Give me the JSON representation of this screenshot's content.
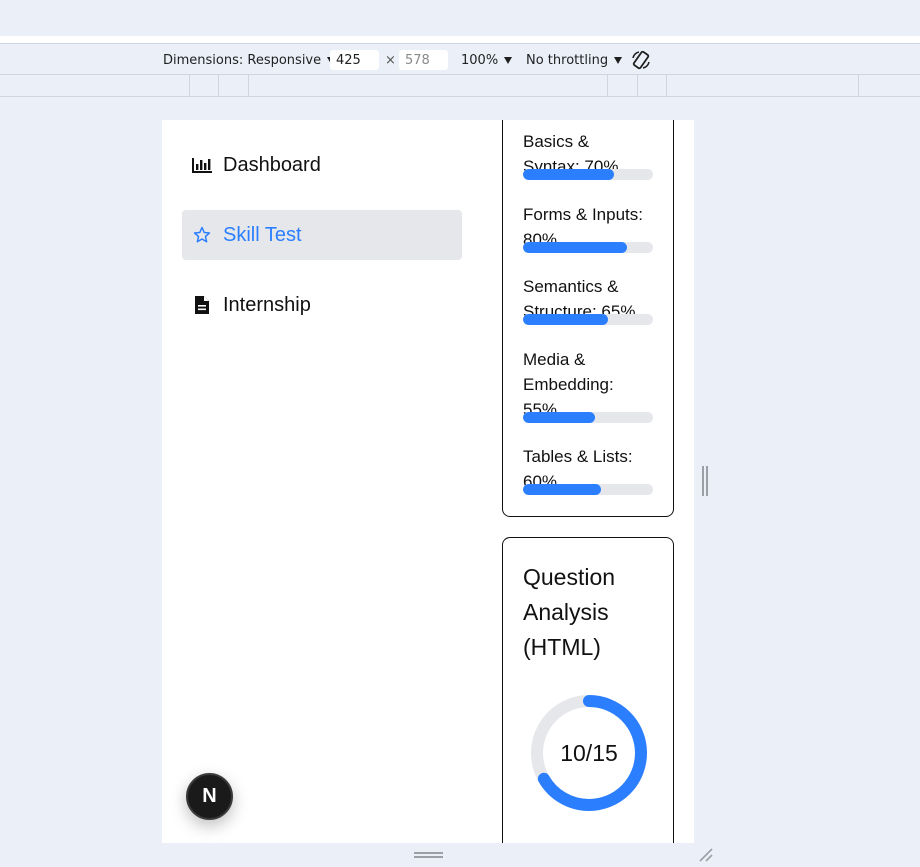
{
  "devtools": {
    "dimensions_label": "Dimensions: Responsive",
    "width_value": "425",
    "times": "×",
    "height_value": "578",
    "zoom": "100%",
    "throttling": "No throttling"
  },
  "sidebar": {
    "items": [
      {
        "label": "Dashboard",
        "icon": "bar-chart-icon",
        "active": false
      },
      {
        "label": "Skill Test",
        "icon": "star-icon",
        "active": true
      },
      {
        "label": "Internship",
        "icon": "document-icon",
        "active": false
      }
    ]
  },
  "skills": [
    {
      "label": "Basics & Syntax: 70%",
      "lines": [
        "Basics &",
        "Syntax: 70%"
      ],
      "percent": 70
    },
    {
      "label": "Forms & Inputs: 80%",
      "lines": [
        "Forms & Inputs:",
        "80%"
      ],
      "percent": 80
    },
    {
      "label": "Semantics & Structure: 65%",
      "lines": [
        "Semantics &",
        "Structure: 65%"
      ],
      "percent": 65
    },
    {
      "label": "Media & Embedding: 55%",
      "lines": [
        "Media &",
        "Embedding:",
        "55%"
      ],
      "percent": 55
    },
    {
      "label": "Tables & Lists: 60%",
      "lines": [
        "Tables & Lists:",
        "60%"
      ],
      "percent": 60
    }
  ],
  "question_analysis": {
    "title_lines": [
      "Question",
      "Analysis",
      "(HTML)"
    ],
    "score_label": "10/15",
    "correct": 10,
    "total": 15
  },
  "badge": {
    "letter": "N"
  },
  "colors": {
    "accent": "#2b7fff",
    "track": "#e5e7eb",
    "active_bg": "#e5e7eb"
  }
}
